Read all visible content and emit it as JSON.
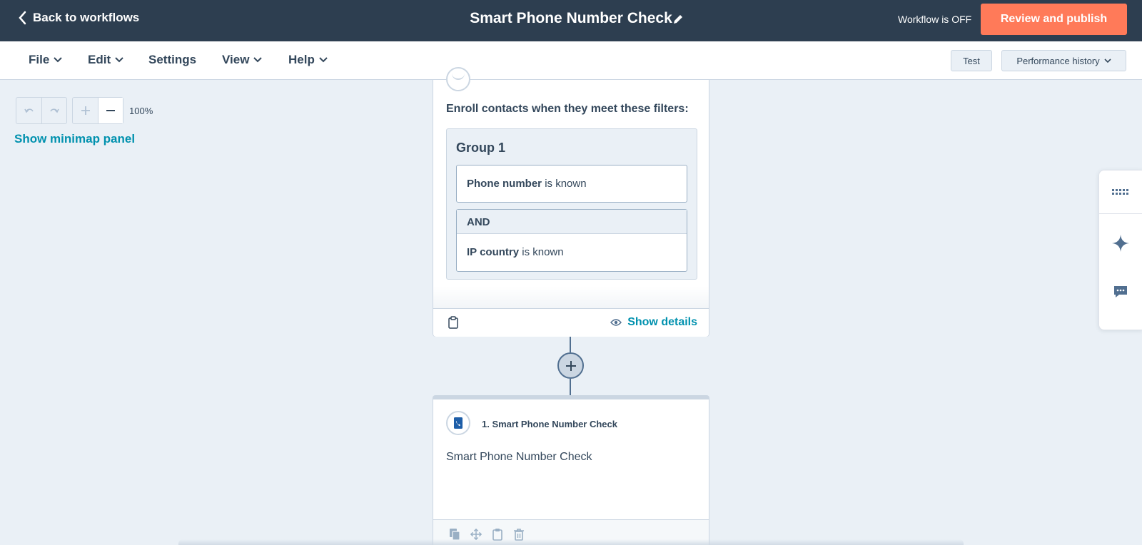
{
  "header": {
    "back_label": "Back to workflows",
    "title": "Smart Phone Number Check",
    "status": "Workflow is OFF",
    "publish_label": "Review and publish"
  },
  "menu": {
    "items": [
      "File",
      "Edit",
      "Settings",
      "View",
      "Help"
    ],
    "test_label": "Test",
    "performance_label": "Performance history"
  },
  "canvas_controls": {
    "zoom_level": "100%",
    "minimap_label": "Show minimap panel"
  },
  "trigger": {
    "heading": "Enroll contacts when they meet these filters:",
    "group_title": "Group 1",
    "filter_1": {
      "property": "Phone number",
      "operator": "is known"
    },
    "and_label": "AND",
    "filter_2": {
      "property": "IP country",
      "operator": "is known"
    },
    "show_details_label": "Show details"
  },
  "action": {
    "title": "1. Smart Phone Number Check",
    "description": "Smart Phone Number Check"
  },
  "colors": {
    "header_bg": "#2d3e50",
    "accent_orange": "#ff7a59",
    "link_teal": "#0091ae",
    "canvas_bg": "#eaf0f6"
  },
  "icons": {
    "back": "chevron-left-icon",
    "edit": "pencil-icon",
    "undo": "undo-icon",
    "redo": "redo-icon",
    "zoom_in": "plus-icon",
    "zoom_out": "minus-icon",
    "add_action": "plus-circle-icon",
    "details": "eye-icon",
    "rail": [
      "keyboard-icon",
      "sparkle-icon",
      "chat-icon"
    ]
  }
}
